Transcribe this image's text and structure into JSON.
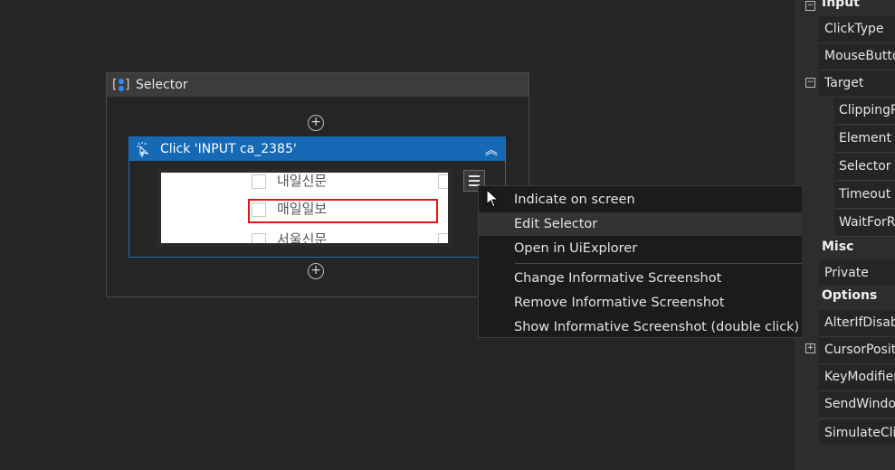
{
  "sequence": {
    "title": "Selector"
  },
  "click_activity": {
    "title": "Click 'INPUT  ca_2385'"
  },
  "screenshot": {
    "items": [
      "내일신문",
      "매일일보",
      "서울신문"
    ]
  },
  "context_menu": {
    "items": [
      "Indicate on screen",
      "Edit Selector",
      "Open in UiExplorer",
      "Change Informative Screenshot",
      "Remove Informative Screenshot",
      "Show Informative Screenshot (double click)"
    ],
    "highlighted": "Edit Selector"
  },
  "properties": {
    "input_category": "Input",
    "misc_category": "Misc",
    "options_category": "Options",
    "rows": {
      "clicktype": "ClickType",
      "mousebutton": "MouseButto",
      "target": "Target",
      "clipping": "ClippingR",
      "element": "Element",
      "selector": "Selector",
      "timeout": "Timeout",
      "waitfor": "WaitForR",
      "private": "Private",
      "alterifdisabled": "AlterIfDisab",
      "cursorposition": "CursorPositi",
      "keymodifiers": "KeyModifier",
      "sendwindow": "SendWindo",
      "simulateclick": "SimulateClic"
    }
  }
}
